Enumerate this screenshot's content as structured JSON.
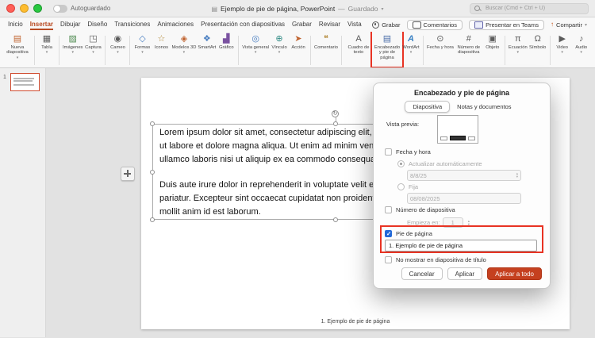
{
  "titlebar": {
    "autosave": "Autoguardado",
    "doc_title": "Ejemplo de pie de página, PowerPoint",
    "status": "Guardado",
    "search_placeholder": "Buscar (Cmd + Ctrl + U)"
  },
  "tabs": [
    {
      "label": "Inicio"
    },
    {
      "label": "Insertar"
    },
    {
      "label": "Dibujar"
    },
    {
      "label": "Diseño"
    },
    {
      "label": "Transiciones"
    },
    {
      "label": "Animaciones"
    },
    {
      "label": "Presentación con diapositivas"
    },
    {
      "label": "Grabar"
    },
    {
      "label": "Revisar"
    },
    {
      "label": "Vista"
    }
  ],
  "top_actions": {
    "record": "Grabar",
    "comments": "Comentarios",
    "teams": "Presentar en Teams",
    "share": "Compartir"
  },
  "ribbon": {
    "buttons": [
      {
        "label": "Nueva diapositiva",
        "glyph": "▤"
      },
      {
        "label": "Tabla",
        "glyph": "▦"
      },
      {
        "label": "Imágenes",
        "glyph": "▨"
      },
      {
        "label": "Captura",
        "glyph": "◳"
      },
      {
        "label": "Cameo",
        "glyph": "◉"
      },
      {
        "label": "Formas",
        "glyph": "◇"
      },
      {
        "label": "Iconos",
        "glyph": "☆"
      },
      {
        "label": "Modelos 3D",
        "glyph": "◈"
      },
      {
        "label": "SmartArt",
        "glyph": "❖"
      },
      {
        "label": "Gráfico",
        "glyph": "▟"
      },
      {
        "label": "Vista general",
        "glyph": "◎"
      },
      {
        "label": "Vínculo",
        "glyph": "⊕"
      },
      {
        "label": "Acción",
        "glyph": "➤"
      },
      {
        "label": "Comentario",
        "glyph": "❝"
      },
      {
        "label": "Cuadro de texto",
        "glyph": "A"
      },
      {
        "label": "Encabezado y pie de página",
        "glyph": "▤"
      },
      {
        "label": "WordArt",
        "glyph": "A"
      },
      {
        "label": "Fecha y hora",
        "glyph": "⊙"
      },
      {
        "label": "Número de diapositiva",
        "glyph": "#"
      },
      {
        "label": "Objeto",
        "glyph": "▣"
      },
      {
        "label": "Ecuación",
        "glyph": "π"
      },
      {
        "label": "Símbolo",
        "glyph": "Ω"
      },
      {
        "label": "Video",
        "glyph": "▶"
      },
      {
        "label": "Audio",
        "glyph": "♪"
      }
    ]
  },
  "slide_panel": {
    "number": "1"
  },
  "slide": {
    "p1": [
      "Lorem ipsum dolor sit amet, consectetur adipiscing elit, sed",
      "ut labore et dolore magna aliqua. Ut enim ad minim veniam,",
      "ullamco laboris nisi ut aliquip ex ea commodo consequat."
    ],
    "p2": [
      "Duis aute irure dolor in reprehenderit in voluptate velit esse c",
      "pariatur. Excepteur sint occaecat cupidatat non proident, sun",
      "mollit anim id est laborum."
    ],
    "footer": "1. Ejemplo de pie de página"
  },
  "dialog": {
    "title": "Encabezado y pie de página",
    "tab_slide": "Diapositiva",
    "tab_notes": "Notas y documentos",
    "preview_label": "Vista previa:",
    "chk_datetime": "Fecha y hora",
    "radio_auto": "Actualizar automáticamente",
    "auto_value": "8/8/25",
    "radio_fixed": "Fija",
    "fixed_value": "08/08/2025",
    "chk_slidenum": "Número de diapositiva",
    "starts_label": "Empieza en:",
    "starts_value": "1",
    "chk_footer": "Pie de página",
    "footer_value": "1. Ejemplo de pie de página",
    "chk_no_title": "No mostrar en diapositiva de título",
    "btn_cancel": "Cancelar",
    "btn_apply": "Aplicar",
    "btn_apply_all": "Aplicar a todo"
  },
  "colors": {
    "accent": "#b84a22",
    "annotation": "#e83323",
    "checkbox_blue": "#2168d7",
    "apply_all_button": "#c5401f"
  }
}
